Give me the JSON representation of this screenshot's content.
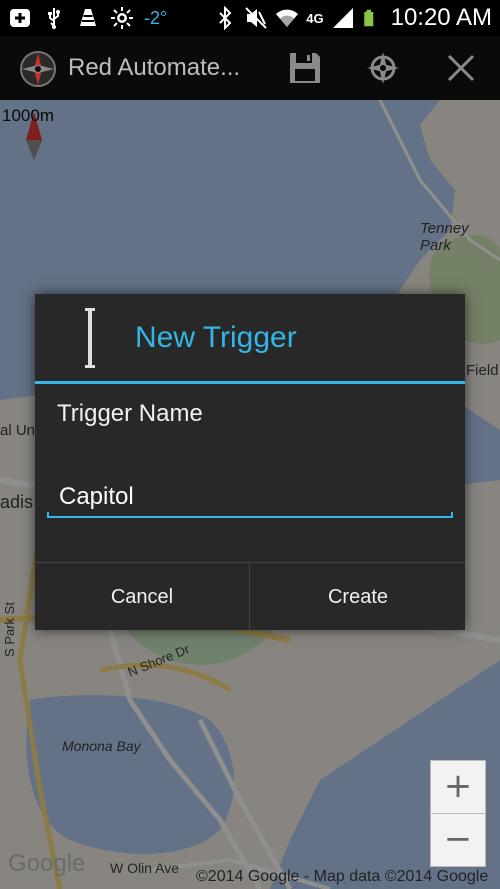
{
  "status_bar": {
    "temperature": "-2°",
    "network": "4G",
    "time": "10:20 AM",
    "icons_left": [
      "add-icon",
      "usb-icon",
      "vlc-cone-icon",
      "brightness-icon"
    ],
    "icons_right": [
      "bluetooth-icon",
      "mute-icon",
      "wifi-icon",
      "signal-icon",
      "battery-icon"
    ]
  },
  "action_bar": {
    "title": "Red Automate...",
    "app_icon": "compass-icon",
    "actions": [
      "save-icon",
      "locate-icon",
      "close-icon"
    ]
  },
  "map": {
    "scale_label": "1000m",
    "labels": {
      "tenney_park": "Tenney Park",
      "field": "Field",
      "al_un": "al Un",
      "adis": "adis",
      "s_park_st": "S Park St",
      "n_shore_dr": "N Shore Dr",
      "monona_bay": "Monona Bay",
      "w_olin_ave": "W Olin Ave"
    },
    "zoom_in": "+",
    "zoom_out": "−",
    "attribution": "©2014 Google - Map data ©2014 Google",
    "logo": "Google"
  },
  "dialog": {
    "title": "New Trigger",
    "field_label": "Trigger Name",
    "field_value": "Capitol",
    "cancel_label": "Cancel",
    "create_label": "Create"
  },
  "colors": {
    "accent": "#33b5e5",
    "dialog_bg": "#282828",
    "water": "#abc5e8",
    "land": "#eae6df"
  }
}
